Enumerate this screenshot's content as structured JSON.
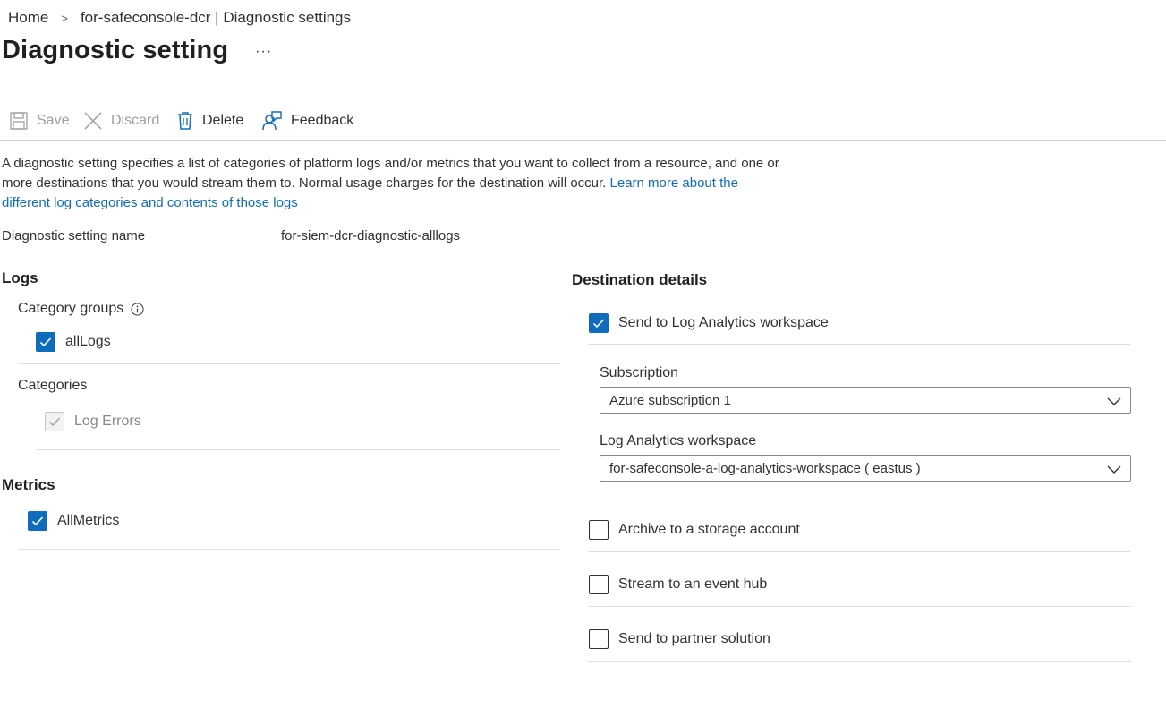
{
  "breadcrumb": {
    "home": "Home",
    "separator": ">",
    "current": "for-safeconsole-dcr | Diagnostic settings"
  },
  "header": {
    "title": "Diagnostic setting",
    "more": "···"
  },
  "toolbar": {
    "save": {
      "label": "Save",
      "icon": "save-icon",
      "enabled": false
    },
    "discard": {
      "label": "Discard",
      "icon": "close-icon",
      "enabled": false
    },
    "delete": {
      "label": "Delete",
      "icon": "trash-icon",
      "enabled": true
    },
    "feedback": {
      "label": "Feedback",
      "icon": "feedback-icon",
      "enabled": true
    }
  },
  "description": {
    "text": "A diagnostic setting specifies a list of categories of platform logs and/or metrics that you want to collect from a resource, and one or more destinations that you would stream them to. Normal usage charges for the destination will occur. ",
    "link_text": "Learn more about the different log categories and contents of those logs"
  },
  "setting_name": {
    "label": "Diagnostic setting name",
    "value": "for-siem-dcr-diagnostic-alllogs"
  },
  "logs": {
    "heading": "Logs",
    "category_groups": {
      "label": "Category groups",
      "items": [
        {
          "label": "allLogs",
          "checked": true
        }
      ]
    },
    "categories": {
      "label": "Categories",
      "items": [
        {
          "label": "Log Errors",
          "checked": true,
          "disabled": true
        }
      ]
    }
  },
  "metrics": {
    "heading": "Metrics",
    "items": [
      {
        "label": "AllMetrics",
        "checked": true
      }
    ]
  },
  "destination": {
    "heading": "Destination details",
    "log_analytics": {
      "label": "Send to Log Analytics workspace",
      "checked": true
    },
    "subscription": {
      "label": "Subscription",
      "value": "Azure subscription 1"
    },
    "workspace": {
      "label": "Log Analytics workspace",
      "value": "for-safeconsole-a-log-analytics-workspace ( eastus )"
    },
    "storage": {
      "label": "Archive to a storage account",
      "checked": false
    },
    "event_hub": {
      "label": "Stream to an event hub",
      "checked": false
    },
    "partner": {
      "label": "Send to partner solution",
      "checked": false
    }
  },
  "colors": {
    "accent": "#0f6cbd",
    "text": "#323130",
    "disabled_text": "#a19f9d",
    "divider": "#e1dfdd"
  }
}
